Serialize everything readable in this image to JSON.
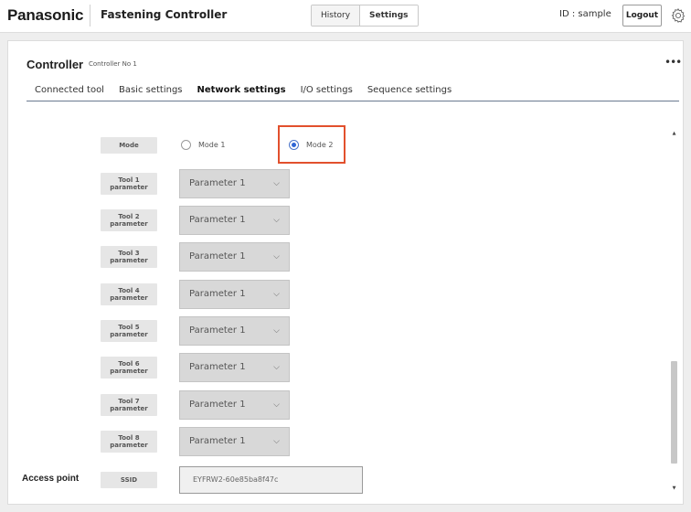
{
  "header": {
    "brand": "Panasonic",
    "app_title": "Fastening Controller",
    "nav": {
      "history": "History",
      "settings": "Settings"
    },
    "user_id": "ID : sample",
    "logout": "Logout"
  },
  "panel": {
    "title": "Controller",
    "subtitle": "Controller No 1",
    "more": "•••",
    "tabs": [
      {
        "label": "Connected tool",
        "active": false
      },
      {
        "label": "Basic settings",
        "active": false
      },
      {
        "label": "Network settings",
        "active": true
      },
      {
        "label": "I/O settings",
        "active": false
      },
      {
        "label": "Sequence settings",
        "active": false
      }
    ]
  },
  "network": {
    "mode_label": "Mode",
    "mode_options": [
      {
        "label": "Mode 1",
        "checked": false
      },
      {
        "label": "Mode 2",
        "checked": true
      }
    ],
    "tools": [
      {
        "label_top": "Tool 1",
        "label_bottom": "parameter",
        "value": "Parameter 1"
      },
      {
        "label_top": "Tool 2",
        "label_bottom": "parameter",
        "value": "Parameter 1"
      },
      {
        "label_top": "Tool 3",
        "label_bottom": "parameter",
        "value": "Parameter 1"
      },
      {
        "label_top": "Tool 4",
        "label_bottom": "parameter",
        "value": "Parameter 1"
      },
      {
        "label_top": "Tool 5",
        "label_bottom": "parameter",
        "value": "Parameter 1"
      },
      {
        "label_top": "Tool 6",
        "label_bottom": "parameter",
        "value": "Parameter 1"
      },
      {
        "label_top": "Tool 7",
        "label_bottom": "parameter",
        "value": "Parameter 1"
      },
      {
        "label_top": "Tool 8",
        "label_bottom": "parameter",
        "value": "Parameter 1"
      }
    ],
    "access_point": {
      "section_label": "Access point",
      "ssid_label": "SSID",
      "ssid_value": "EYFRW2-60e85ba8f47c"
    }
  },
  "scrollbar": {
    "up": "▲",
    "down": "▼"
  },
  "colors": {
    "highlight": "#e2502d",
    "radio_checked": "#2f66d6",
    "tab_underline": "#6a7a90",
    "select_bg": "#d8d8d8"
  },
  "icons": {
    "settings": "gear-icon",
    "more": "more-icon",
    "dropdown": "chevron-down-icon"
  }
}
